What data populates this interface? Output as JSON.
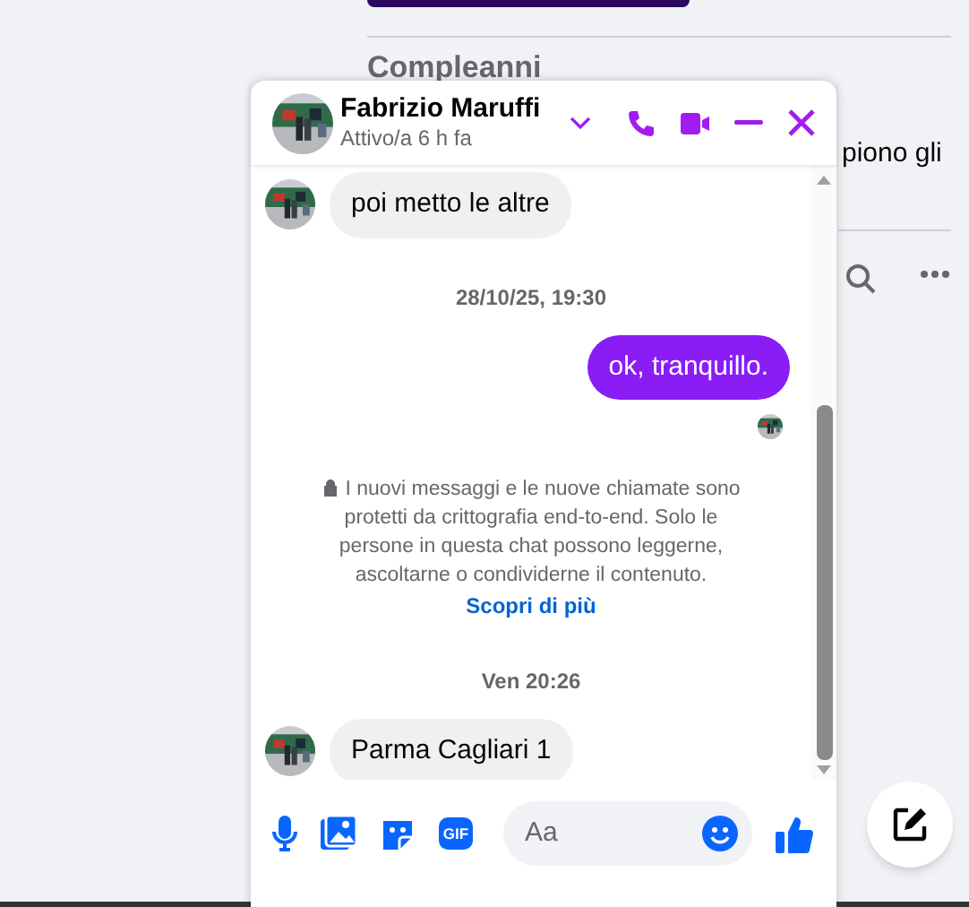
{
  "background": {
    "birthday_heading": "Compleanni",
    "text_fragment": "piono gli"
  },
  "chat": {
    "contact_name": "Fabrizio Maruffi",
    "status": "Attivo/a 6 h fa",
    "messages": [
      {
        "kind": "incoming",
        "text": "poi metto le altre"
      },
      {
        "kind": "timestamp",
        "text": "28/10/25, 19:30"
      },
      {
        "kind": "outgoing",
        "text": "ok, tranquillo."
      },
      {
        "kind": "seen"
      },
      {
        "kind": "notice",
        "text": "I nuovi messaggi e le nuove chiamate sono protetti da crittografia end-to-end. Solo le persone in questa chat possono leggerne, ascoltarne o condividerne il contenuto.",
        "link": "Scopri di più"
      },
      {
        "kind": "timestamp",
        "text": "Ven 20:26"
      },
      {
        "kind": "incoming",
        "text": "Parma Cagliari 1"
      }
    ],
    "composer": {
      "gif_label": "GIF",
      "placeholder": "Aa"
    }
  }
}
